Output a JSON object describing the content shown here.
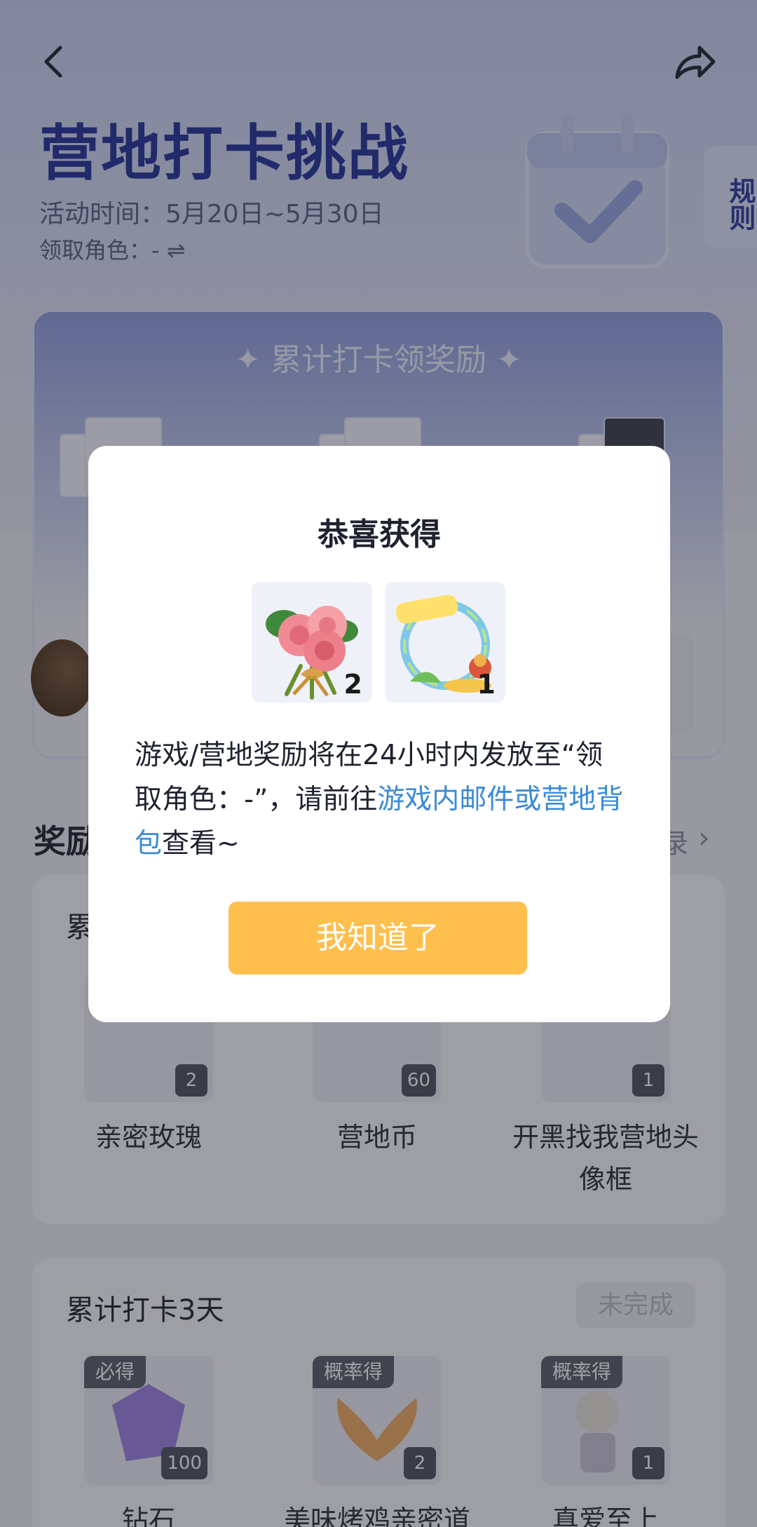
{
  "header": {
    "title": "营地打卡挑战",
    "activity_time": "活动时间：5月20日~5月30日",
    "role_line": "领取角色：- ⇌",
    "rules_tab": "规则"
  },
  "checkin_card": {
    "title": "✦ 累计打卡领奖励 ✦"
  },
  "rewards": {
    "heading": "奖励",
    "records_link": "录",
    "sections": [
      {
        "title": "累",
        "status": "",
        "items": [
          {
            "tag": "",
            "count": "2",
            "name": "亲密玫瑰"
          },
          {
            "tag": "",
            "count": "60",
            "name": "营地币"
          },
          {
            "tag": "",
            "count": "1",
            "name": "开黑找我营地头像框"
          }
        ]
      },
      {
        "title": "累计打卡3天",
        "status": "未完成",
        "items": [
          {
            "tag": "必得",
            "count": "100",
            "name": "钻石"
          },
          {
            "tag": "概率得",
            "count": "2",
            "name": "美味烤鸡亲密道"
          },
          {
            "tag": "概率得",
            "count": "1",
            "name": "真爱至上"
          }
        ]
      }
    ]
  },
  "modal": {
    "title": "恭喜获得",
    "prizes": [
      {
        "icon": "rose-bouquet-icon",
        "count": "2"
      },
      {
        "icon": "avatar-frame-icon",
        "count": "1"
      }
    ],
    "message_prefix": "游戏/营地奖励将在24小时内发放至“领取角色：-”，请前往",
    "message_link": "游戏内邮件或营地背包",
    "message_suffix": "查看~",
    "button_label": "我知道了"
  },
  "colors": {
    "title": "#24349c",
    "link": "#3b8ad6",
    "button": "#ffbf4d"
  }
}
